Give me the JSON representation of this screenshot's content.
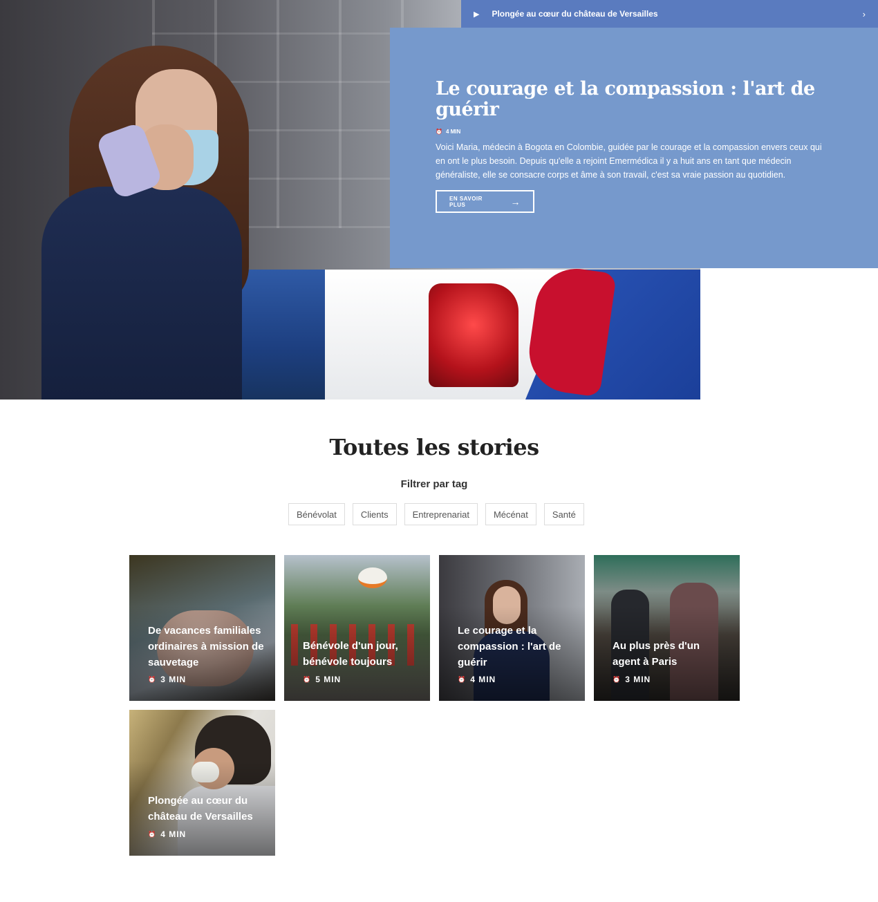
{
  "top_bar": {
    "play_icon": "play-icon",
    "label": "Plongée au cœur du château de Versailles",
    "chevron_icon": "chevron-right-icon"
  },
  "feature": {
    "title": "Le courage et la compassion : l'art de guérir",
    "read_time": "4 MIN",
    "description": "Voici Maria, médecin à Bogota en Colombie, guidée par le courage et la compassion envers ceux qui en ont le plus besoin. Depuis qu'elle a rejoint Emermédica il y a huit ans en tant que médecin généraliste, elle se consacre corps et âme à son travail, c'est sa vraie passion au quotidien.",
    "cta_label": "EN SAVOIR PLUS",
    "panel_color": "#7699cc"
  },
  "section": {
    "title": "Toutes les stories",
    "filter_label": "Filtrer par tag",
    "tags": [
      "Bénévolat",
      "Clients",
      "Entreprenariat",
      "Mécénat",
      "Santé"
    ]
  },
  "cards": [
    {
      "title": "De vacances familiales ordinaires à mission de sauvetage",
      "read_time": "3 MIN"
    },
    {
      "title": "Bénévole d'un jour, bénévole toujours",
      "read_time": "5 MIN"
    },
    {
      "title": "Le courage et la compassion : l'art de guérir",
      "read_time": "4 MIN"
    },
    {
      "title": "Au plus près d'un agent à Paris",
      "read_time": "3 MIN"
    },
    {
      "title": "Plongée au cœur du château de Versailles",
      "read_time": "4 MIN"
    }
  ]
}
